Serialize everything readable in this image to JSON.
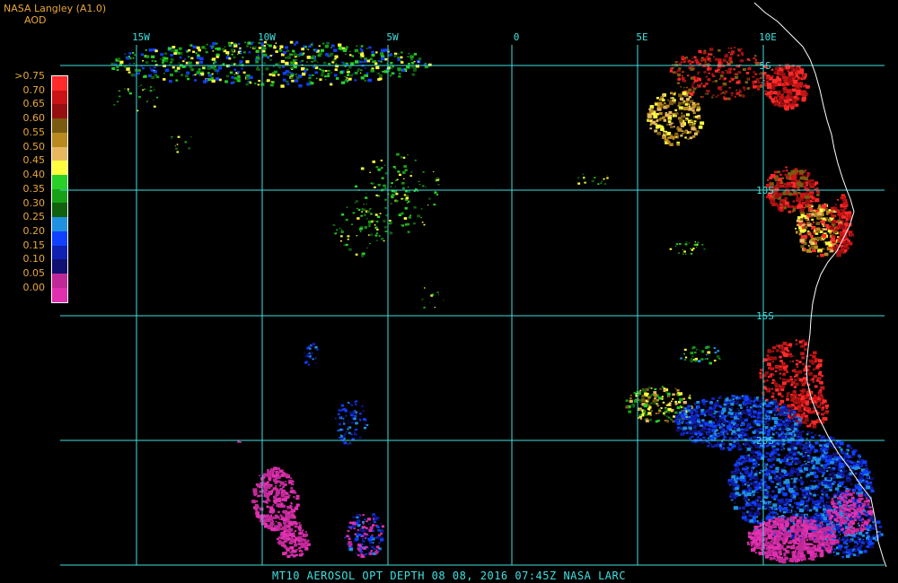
{
  "header": {
    "title": "NASA Langley (A1.0)",
    "subtitle": "AOD"
  },
  "legend": {
    "labels": [
      ">0.75",
      "0.70",
      "0.65",
      "0.60",
      "0.55",
      "0.50",
      "0.45",
      "0.40",
      "0.35",
      "0.30",
      "0.25",
      "0.20",
      "0.15",
      "0.10",
      "0.05",
      "0.00"
    ],
    "colors": [
      "#ff2a2a",
      "#c81414",
      "#961010",
      "#7a5a10",
      "#b88a20",
      "#e8b860",
      "#ffff40",
      "#28d028",
      "#18a018",
      "#106010",
      "#2090e0",
      "#1040ff",
      "#1020b0",
      "#101070",
      "#c02898",
      "#e030b0"
    ]
  },
  "map": {
    "longitude_labels": [
      "15W",
      "10W",
      "5W",
      "0",
      "5E",
      "10E"
    ],
    "latitude_labels": [
      "5S",
      "10S",
      "15S",
      "20S"
    ],
    "grid_color": "#40e0e0",
    "coast_color": "#ffffff"
  },
  "footer": {
    "caption": "MT10  AEROSOL OPT DEPTH   08 08, 2016 07:45Z   NASA LARC"
  }
}
